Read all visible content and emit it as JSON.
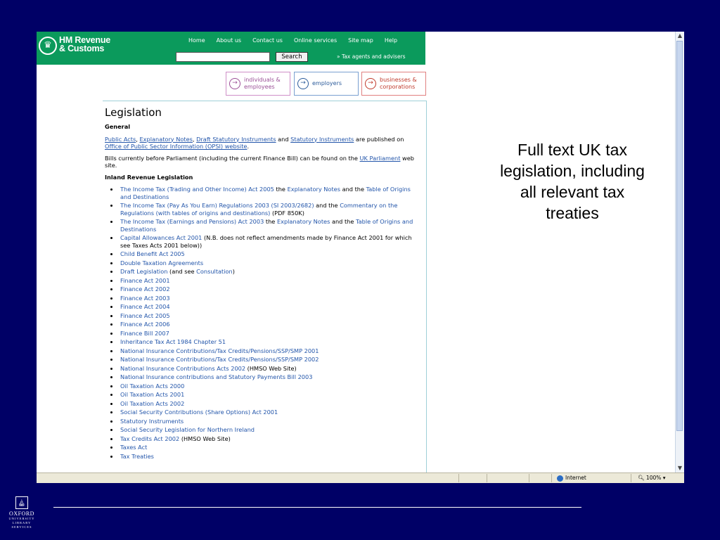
{
  "header": {
    "logo_line1": "HM Revenue",
    "logo_line2": "& Customs",
    "nav": [
      "Home",
      "About us",
      "Contact us",
      "Online services",
      "Site map",
      "Help"
    ],
    "search_button": "Search",
    "tax_agents_link": "» Tax agents and advisers"
  },
  "audience_tabs": [
    {
      "line1": "individuals &",
      "line2": "employees"
    },
    {
      "line1": "employers",
      "line2": ""
    },
    {
      "line1": "businesses &",
      "line2": "corporations"
    }
  ],
  "content": {
    "title": "Legislation",
    "general_heading": "General",
    "para1": {
      "public_acts": "Public Acts",
      "sep1": ", ",
      "explanatory_notes": "Explanatory Notes",
      "sep2": ", ",
      "draft_si": "Draft Statutory Instruments",
      "and": " and ",
      "si": "Statutory Instruments",
      "published": " are published on ",
      "opsi": "Office of Public Sector Information (OPSI) website",
      "end": "."
    },
    "para2": {
      "text": "Bills currently before Parliament (including the current Finance Bill) can be found on the ",
      "uk_parliament": "UK Parliament",
      "end": " web site."
    },
    "inland_heading": "Inland Revenue Legislation",
    "items": [
      {
        "parts": [
          {
            "t": "The Income Tax (Trading and Other Income) Act 2005",
            "l": true
          },
          {
            "t": " the ",
            "l": false
          },
          {
            "t": "Explanatory Notes",
            "l": true
          },
          {
            "t": " and the ",
            "l": false
          },
          {
            "t": "Table of Origins and Destinations",
            "l": true
          }
        ]
      },
      {
        "parts": [
          {
            "t": "The Income Tax (Pay As You Earn) Regulations 2003 (SI 2003/2682)",
            "l": true
          },
          {
            "t": " and the ",
            "l": false
          },
          {
            "t": "Commentary on the Regulations (with tables of origins and destinations)",
            "l": true
          },
          {
            "t": " (PDF 850K)",
            "l": false
          }
        ]
      },
      {
        "parts": [
          {
            "t": "The Income Tax (Earnings and Pensions) Act 2003",
            "l": true
          },
          {
            "t": " the ",
            "l": false
          },
          {
            "t": "Explanatory Notes",
            "l": true
          },
          {
            "t": " and the ",
            "l": false
          },
          {
            "t": "Table of Origins and Destinations",
            "l": true
          }
        ]
      },
      {
        "parts": [
          {
            "t": "Capital Allowances Act 2001",
            "l": true
          },
          {
            "t": " (N.B. does not reflect amendments made by Finance Act 2001 for which see Taxes Acts 2001 below))",
            "l": false
          }
        ]
      },
      {
        "parts": [
          {
            "t": "Child Benefit Act 2005",
            "l": true
          }
        ]
      },
      {
        "parts": [
          {
            "t": "Double Taxation Agreements",
            "l": true
          }
        ]
      },
      {
        "parts": [
          {
            "t": "Draft Legislation",
            "l": true
          },
          {
            "t": " (and see ",
            "l": false
          },
          {
            "t": "Consultation",
            "l": true
          },
          {
            "t": ")",
            "l": false
          }
        ]
      },
      {
        "parts": [
          {
            "t": "Finance Act 2001",
            "l": true
          }
        ]
      },
      {
        "parts": [
          {
            "t": "Finance Act 2002",
            "l": true
          }
        ]
      },
      {
        "parts": [
          {
            "t": "Finance Act 2003",
            "l": true
          }
        ]
      },
      {
        "parts": [
          {
            "t": "Finance Act 2004",
            "l": true
          }
        ]
      },
      {
        "parts": [
          {
            "t": "Finance Act 2005",
            "l": true
          }
        ]
      },
      {
        "parts": [
          {
            "t": "Finance Act 2006",
            "l": true
          }
        ]
      },
      {
        "parts": [
          {
            "t": "Finance Bill 2007",
            "l": true
          }
        ]
      },
      {
        "parts": [
          {
            "t": "Inheritance Tax Act 1984 Chapter 51",
            "l": true
          }
        ]
      },
      {
        "parts": [
          {
            "t": "National Insurance Contributions/Tax Credits/Pensions/SSP/SMP 2001",
            "l": true
          }
        ]
      },
      {
        "parts": [
          {
            "t": "National Insurance Contributions/Tax Credits/Pensions/SSP/SMP 2002",
            "l": true
          }
        ]
      },
      {
        "parts": [
          {
            "t": "National Insurance Contributions Acts 2002",
            "l": true
          },
          {
            "t": " (HMSO Web Site)",
            "l": false
          }
        ]
      },
      {
        "parts": [
          {
            "t": "National Insurance contributions and Statutory Payments Bill 2003",
            "l": true
          }
        ]
      },
      {
        "parts": [
          {
            "t": "Oil Taxation Acts 2000",
            "l": true
          }
        ]
      },
      {
        "parts": [
          {
            "t": "Oil Taxation Acts 2001",
            "l": true
          }
        ]
      },
      {
        "parts": [
          {
            "t": "Oil Taxation Acts 2002",
            "l": true
          }
        ]
      },
      {
        "parts": [
          {
            "t": "Social Security Contributions (Share Options) Act 2001",
            "l": true
          }
        ]
      },
      {
        "parts": [
          {
            "t": "Statutory Instruments",
            "l": true
          }
        ]
      },
      {
        "parts": [
          {
            "t": "Social Security Legislation for Northern Ireland",
            "l": true
          }
        ]
      },
      {
        "parts": [
          {
            "t": "Tax Credits Act 2002",
            "l": true
          },
          {
            "t": " (HMSO Web Site)",
            "l": false
          }
        ]
      },
      {
        "parts": [
          {
            "t": "Taxes Act",
            "l": true
          }
        ]
      },
      {
        "parts": [
          {
            "t": "Tax Treaties",
            "l": true
          }
        ]
      }
    ]
  },
  "statusbar": {
    "zone": "Internet",
    "zoom": "100%"
  },
  "caption": "Full text UK tax legislation, including all relevant tax treaties",
  "oxford": {
    "line1": "OXFORD",
    "line2": "UNIVERSITY",
    "line3": "LIBRARY",
    "line4": "SERVICES"
  },
  "colors": {
    "slide_bg": "#000066",
    "hmrc_green": "#0b9a5c",
    "link": "#2255aa"
  }
}
